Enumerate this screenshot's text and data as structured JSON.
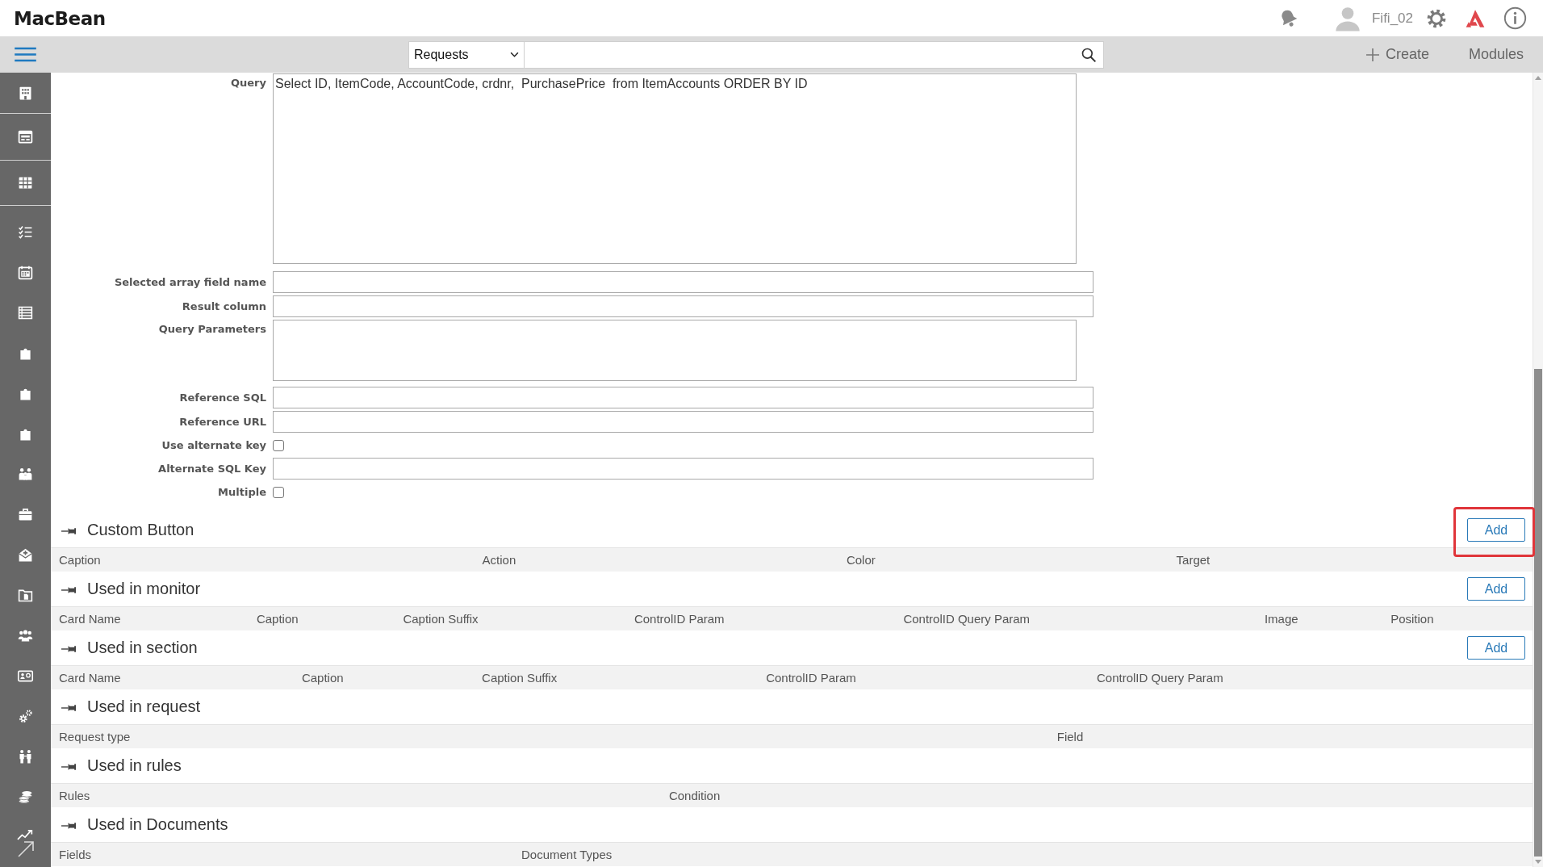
{
  "header": {
    "logo": "MacBean",
    "username": "Fifi_02"
  },
  "toolbar": {
    "module_select": {
      "value": "Requests"
    },
    "create_button": {
      "label": "Create"
    },
    "modules_link": {
      "label": "Modules"
    }
  },
  "form": {
    "fields": [
      {
        "kind": "code",
        "label": "Query",
        "value": "Select ID, ItemCode, AccountCode, crdnr,  PurchasePrice  from ItemAccounts ORDER BY ID"
      },
      {
        "kind": "text",
        "label": "Selected array field name"
      },
      {
        "kind": "text",
        "label": "Result column"
      },
      {
        "kind": "textarea",
        "label": "Query Parameters"
      },
      {
        "kind": "text",
        "label": "Reference SQL"
      },
      {
        "kind": "text",
        "label": "Reference URL"
      },
      {
        "kind": "checkbox",
        "label": "Use alternate key",
        "checked": false
      },
      {
        "kind": "text",
        "label": "Alternate SQL Key"
      },
      {
        "kind": "checkbox",
        "label": "Multiple",
        "checked": false
      }
    ]
  },
  "sections": [
    {
      "title": "Custom Button",
      "add_button": {
        "label": "Add",
        "highlighted": true
      },
      "columns": [
        "Caption",
        "Action",
        "Color",
        "Target"
      ]
    },
    {
      "title": "Used in monitor",
      "add_button": {
        "label": "Add",
        "highlighted": false
      },
      "columns": [
        "Card Name",
        "Caption",
        "Caption Suffix",
        "ControlID Param",
        "ControlID Query Param",
        "Image",
        "Position"
      ]
    },
    {
      "title": "Used in section",
      "add_button": {
        "label": "Add",
        "highlighted": false
      },
      "columns": [
        "Card Name",
        "Caption",
        "Caption Suffix",
        "ControlID Param",
        "ControlID Query Param"
      ]
    },
    {
      "title": "Used in request",
      "columns": [
        "Request type",
        "Field"
      ]
    },
    {
      "title": "Used in rules",
      "columns": [
        "Rules",
        "Condition"
      ]
    },
    {
      "title": "Used in Documents",
      "columns": [
        "Fields",
        "Document Types"
      ]
    }
  ]
}
